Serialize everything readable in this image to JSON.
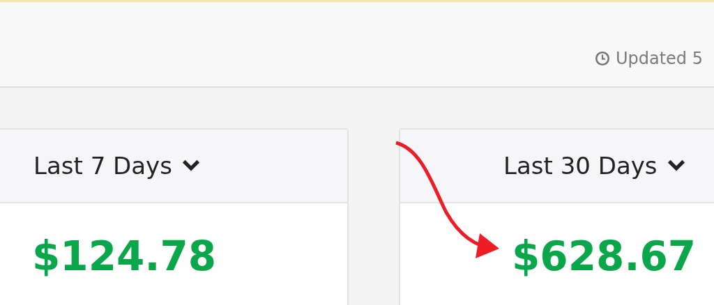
{
  "header": {
    "updated": "Updated 5"
  },
  "cards": [
    {
      "period": "Last 7 Days",
      "amount": "$124.78"
    },
    {
      "period": "Last 30 Days",
      "amount": "$628.67"
    }
  ]
}
